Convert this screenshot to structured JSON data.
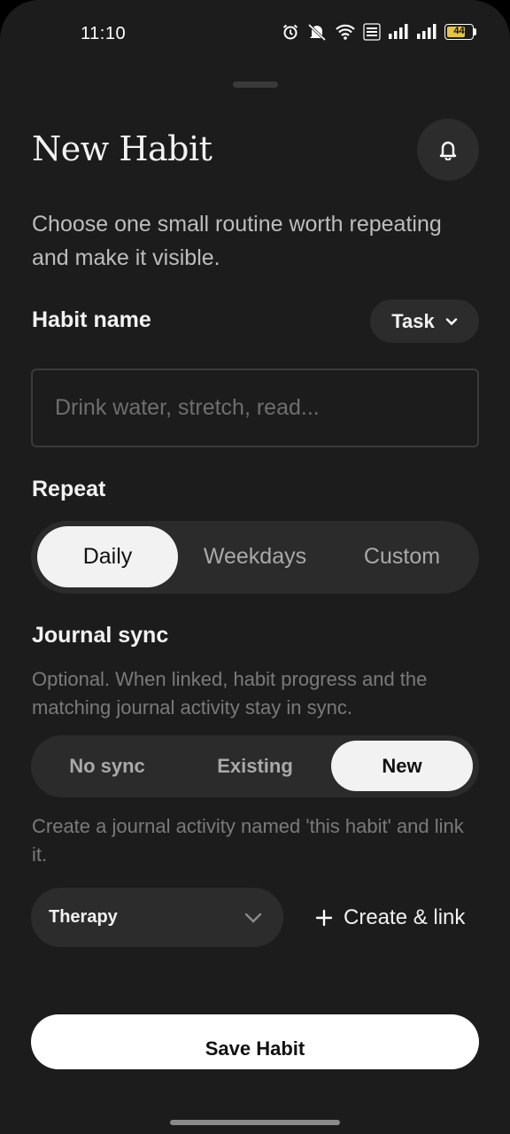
{
  "status_bar": {
    "time": "11:10",
    "battery": "44"
  },
  "header": {
    "title": "New Habit"
  },
  "intro": "Choose one small routine worth repeating and make it visible.",
  "habit_name": {
    "label": "Habit name",
    "type_selector": "Task",
    "placeholder": "Drink water, stretch, read..."
  },
  "repeat": {
    "label": "Repeat",
    "options": [
      "Daily",
      "Weekdays",
      "Custom"
    ],
    "selected": "Daily"
  },
  "journal_sync": {
    "label": "Journal sync",
    "description": "Optional. When linked, habit progress and the matching journal activity stay in sync.",
    "options": [
      "No sync",
      "Existing",
      "New"
    ],
    "selected": "New",
    "hint": "Create a journal activity named 'this habit' and link it.",
    "category": "Therapy",
    "create_link_label": "Create & link"
  },
  "save_label": "Save Habit",
  "colors": {
    "background": "#1c1c1c",
    "surface": "#2c2c2c",
    "active": "#f2f2f2"
  }
}
